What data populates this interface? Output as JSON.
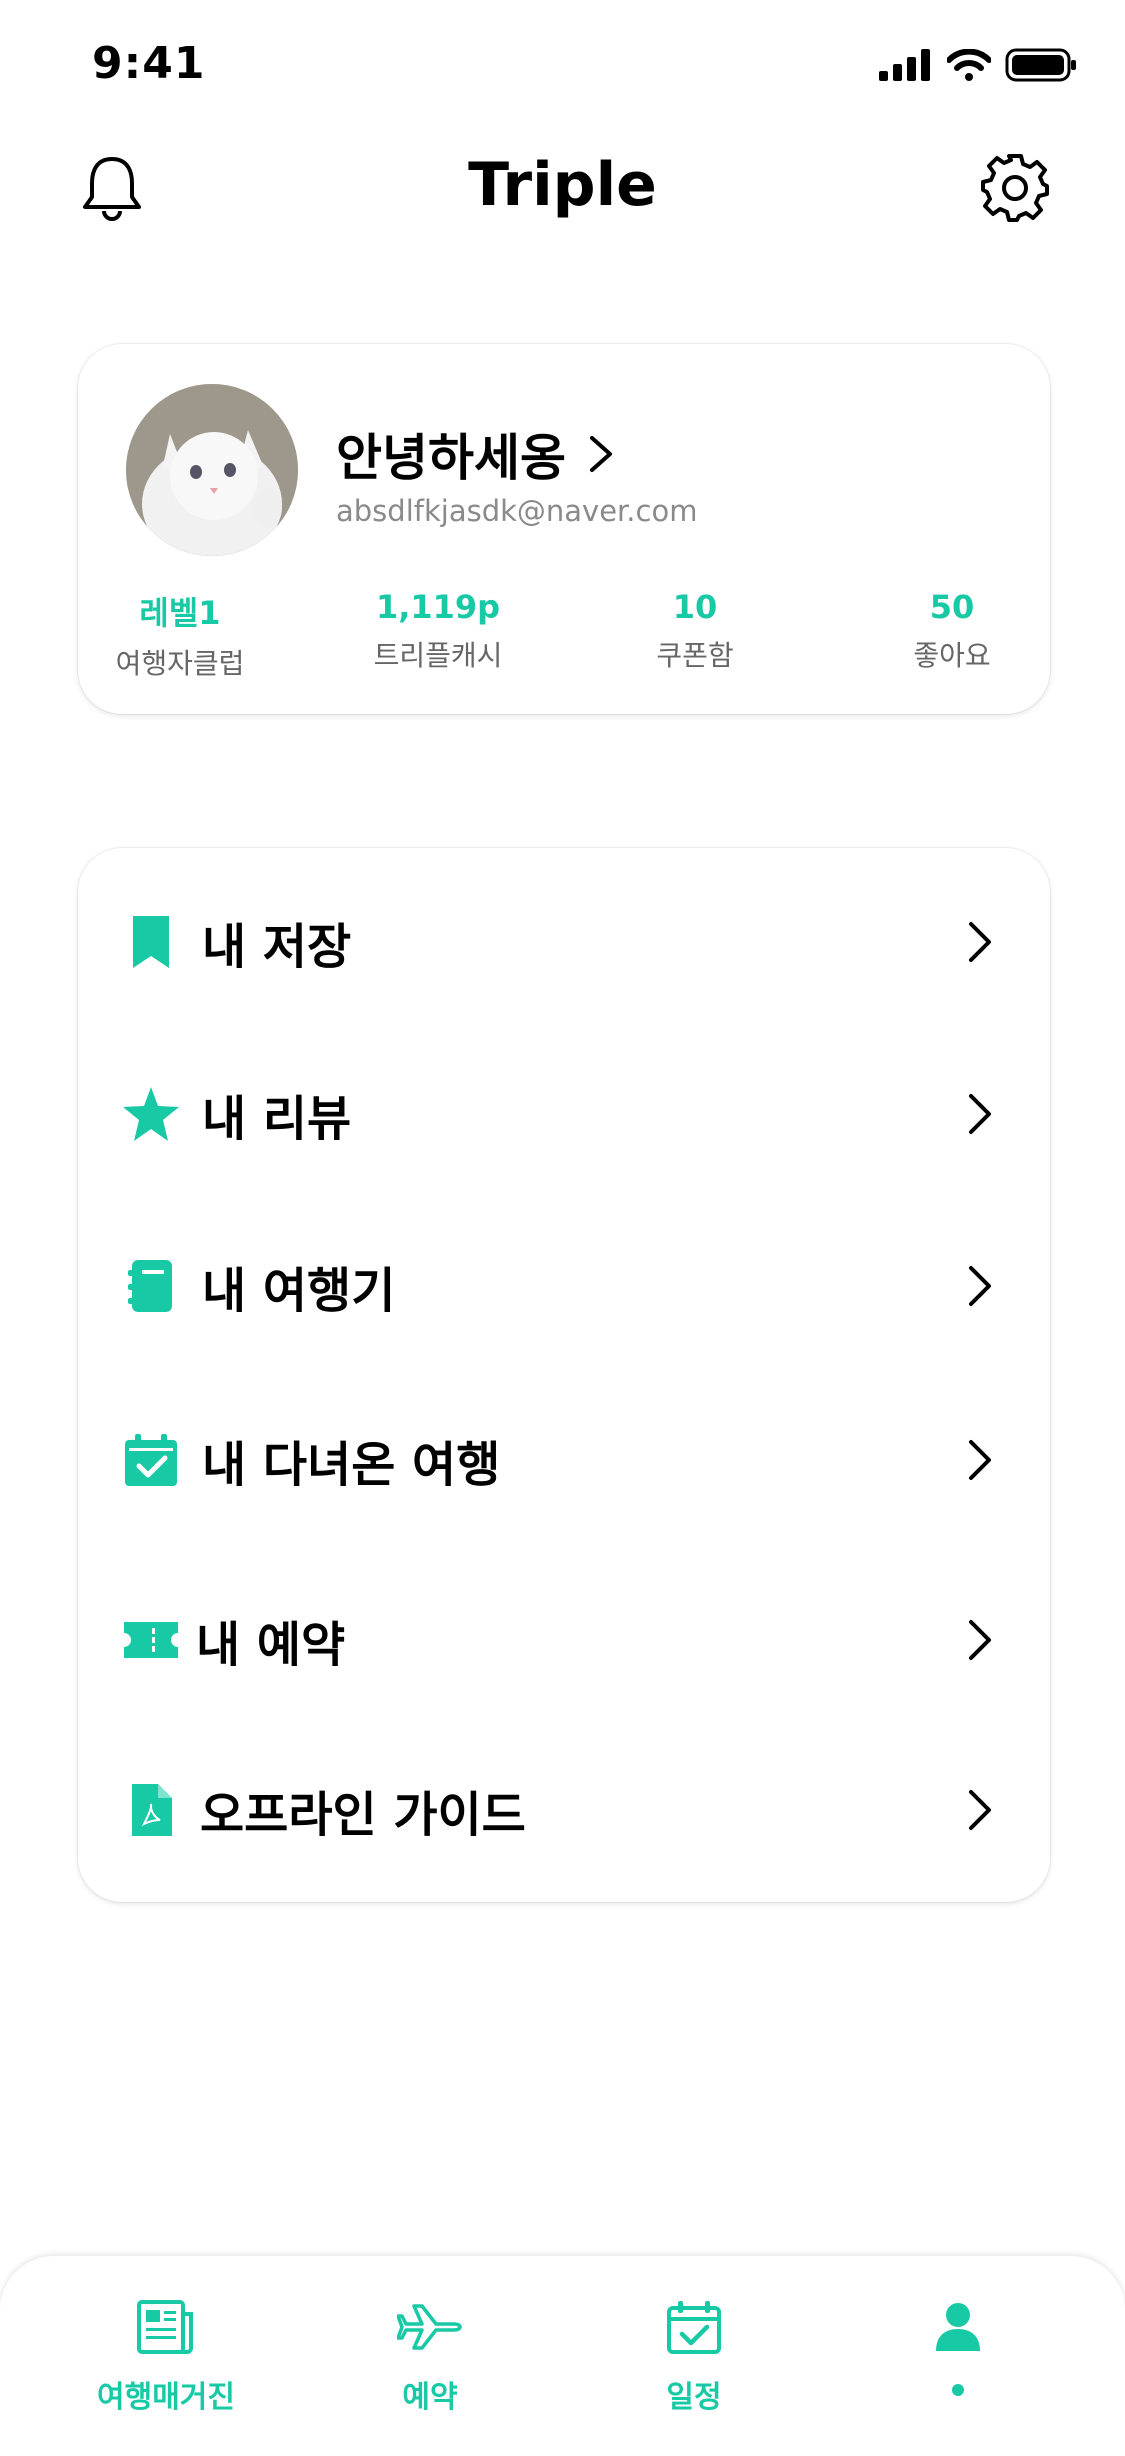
{
  "status_bar": {
    "time": "9:41"
  },
  "header": {
    "title": "Triple"
  },
  "profile": {
    "greeting": "안녕하세옹",
    "email": "absdlfkjasdk@naver.com",
    "stats": [
      {
        "value": "레벨1",
        "label": "여행자클럽"
      },
      {
        "value": "1,119p",
        "label": "트리플캐시"
      },
      {
        "value": "10",
        "label": "쿠폰함"
      },
      {
        "value": "50",
        "label": "좋아요"
      }
    ]
  },
  "menu": [
    {
      "label": "내 저장",
      "icon": "bookmark-icon"
    },
    {
      "label": "내 리뷰",
      "icon": "star-icon"
    },
    {
      "label": "내 여행기",
      "icon": "notebook-icon"
    },
    {
      "label": "내 다녀온 여행",
      "icon": "calendar-check-icon"
    },
    {
      "label": "내 예약",
      "icon": "ticket-icon"
    },
    {
      "label": "오프라인 가이드",
      "icon": "pdf-file-icon"
    }
  ],
  "tabs": [
    {
      "label": "여행매거진",
      "icon": "magazine-icon"
    },
    {
      "label": "예약",
      "icon": "airplane-icon"
    },
    {
      "label": "일정",
      "icon": "calendar-check-icon"
    },
    {
      "label": "",
      "icon": "person-icon"
    }
  ],
  "colors": {
    "accent": "#18c9a5",
    "text": "#000000",
    "muted": "#8a8a8a"
  }
}
